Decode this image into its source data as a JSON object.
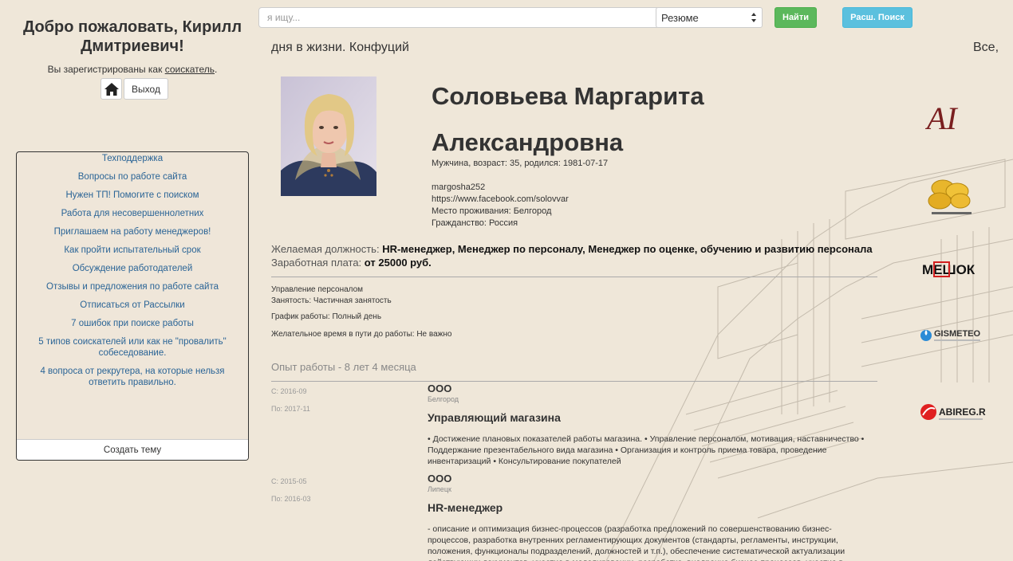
{
  "welcome": {
    "title": "Добро пожаловать, Кирилл Дмитриевич!",
    "registered_prefix": "Вы зарегистрированы как ",
    "registered_role": "соискатель",
    "registered_suffix": "."
  },
  "auth": {
    "logout_label": "Выход"
  },
  "topics": {
    "items": [
      "Техподдержка",
      "Вопросы по работе сайта",
      "Нужен ТП! Помогите с поиском",
      "Работа для несовершеннолетних",
      "Приглашаем на работу менеджеров!",
      "Как пройти испытательный срок",
      "Обсуждение работодателей",
      "Отзывы и предложения по работе сайта",
      "Отписаться от Рассылки",
      "7 ошибок при поиске работы",
      "5 типов соискателей или как не \"провалить\" собеседование.",
      "4 вопроса от рекрутера, на которые нельзя ответить правильно."
    ],
    "create_label": "Создать тему"
  },
  "search": {
    "placeholder": "я ищу...",
    "select_value": "Резюме",
    "find_label": "Найти",
    "advanced_label": "Расш. Поиск"
  },
  "ticker": {
    "left_text": "дня в жизни. Конфуций",
    "right_text": "Все, "
  },
  "profile": {
    "name_line1": "Соловьева Маргарита",
    "name_line2": "Александровна",
    "gender_age": "Мужчина, возраст: 35, родился: 1981-07-17",
    "username": "margosha252",
    "facebook": "https://www.facebook.com/solovvar",
    "residence": "Место проживания: Белгород",
    "citizenship": "Гражданство: Россия",
    "desired_label": "Желаемая должность:",
    "desired_value": "HR-менеджер, Менеджер по персоналу, Менеджер по оценке, обучению и развитию персонала",
    "salary_label": "Заработная плата:",
    "salary_value": "от 25000 руб.",
    "field": "Управление персоналом",
    "employment": "Занятость: Частичная занятость",
    "schedule": "График работы: Полный день",
    "commute": "Желательное время в пути до работы: Не важно",
    "experience_title": "Опыт работы - 8 лет 4 месяца"
  },
  "jobs": [
    {
      "from": "С: 2016-09",
      "to": "По: 2017-11",
      "company": "ООО",
      "city": "Белгород",
      "position": "Управляющий магазина",
      "description": "• Достижение плановых показателей работы магазина. • Управление персоналом, мотивация, наставничество • Поддержание презентабельного вида магазина • Организация и контроль приема товара, проведение инвентаризаций • Консультирование покупателей"
    },
    {
      "from": "С: 2015-05",
      "to": "По: 2016-03",
      "company": "ООО",
      "city": "Липецк",
      "position": "HR-менеджер",
      "description": "- описание и оптимизация бизнес-процессов (разработка предложений по совершенствованию бизнес-процессов, разработка внутренних регламентирующих документов (стандарты, регламенты, инструкции, положения, функционалы подразделений, должностей и т.п.), обеспечение систематической актуализации действующих документов, участие в моделировании, разработка, внедрение бизнес-процессов, участие в"
    }
  ],
  "logos": {
    "ai": "AI",
    "mewok": "МЕШОК",
    "gismeteo": "GISMETEO",
    "abireg": "ABIREG.RU"
  },
  "colors": {
    "link": "#2a6496",
    "success": "#5cb85c",
    "info": "#5bc0de",
    "background": "#efe7d9"
  }
}
